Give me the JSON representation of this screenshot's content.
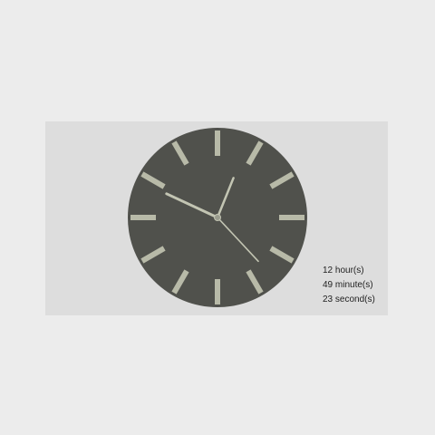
{
  "clock": {
    "hours": 12,
    "minutes": 49,
    "seconds": 23,
    "colors": {
      "face": "#50514c",
      "marks": "#b8baa8",
      "hands": "#c3c5b3",
      "center": "#9a9c8e",
      "panel": "#dddddd",
      "background": "#ececec"
    }
  },
  "readout": {
    "hours_text": "12 hour(s)",
    "minutes_text": "49 minute(s)",
    "seconds_text": "23 second(s)"
  }
}
